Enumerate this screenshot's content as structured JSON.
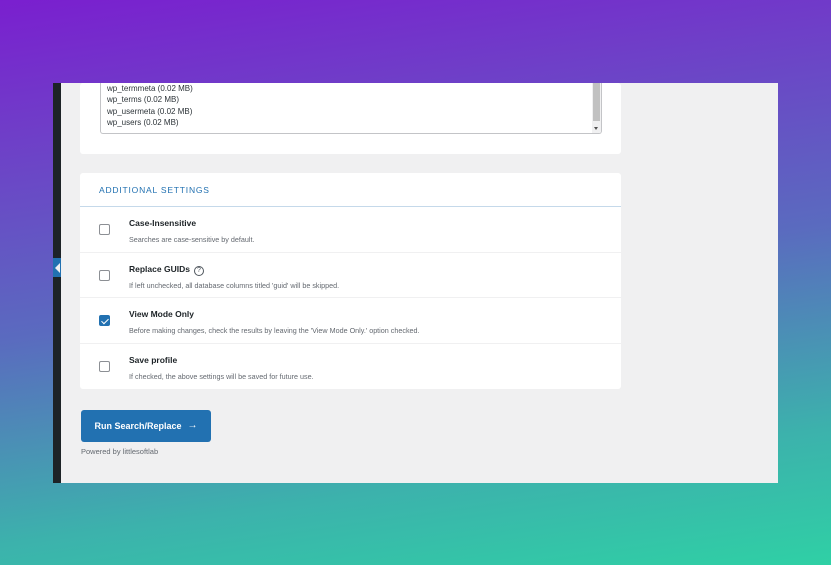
{
  "tables": {
    "items": [
      "wp_termmeta (0.02 MB)",
      "wp_terms (0.02 MB)",
      "wp_usermeta (0.02 MB)",
      "wp_users (0.02 MB)"
    ]
  },
  "settings": {
    "title": "ADDITIONAL SETTINGS",
    "items": [
      {
        "label": "Case-Insensitive",
        "description": "Searches are case-sensitive by default.",
        "checked": false
      },
      {
        "label": "Replace GUIDs",
        "description": "If left unchecked, all database columns titled 'guid' will be skipped.",
        "checked": false,
        "help_icon": "?"
      },
      {
        "label": "View Mode Only",
        "description": "Before making changes, check the results by leaving the 'View Mode Only.' option checked.",
        "checked": true
      },
      {
        "label": "Save profile",
        "description": "If checked, the above settings will be saved for future use.",
        "checked": false
      }
    ]
  },
  "actions": {
    "run_label": "Run Search/Replace",
    "run_icon": "→"
  },
  "footer": {
    "powered_by": "Powered by littlesoftlab"
  },
  "colors": {
    "accent": "#2271b1",
    "admin_bar": "#1d2327",
    "page_bg": "#f0f0f1"
  }
}
